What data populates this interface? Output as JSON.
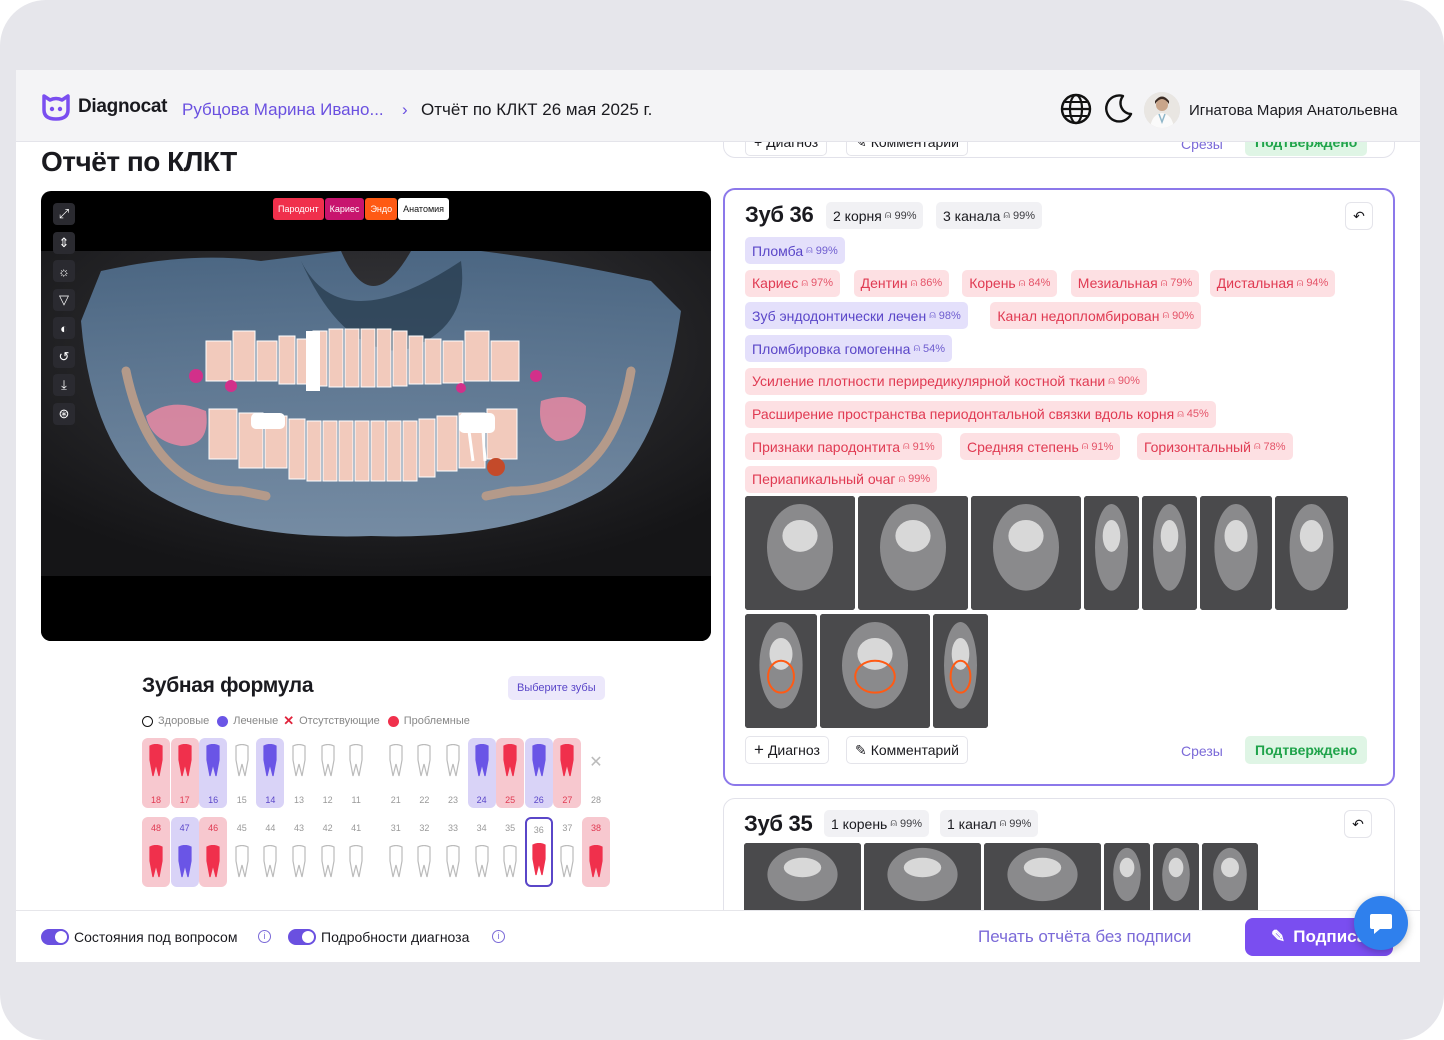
{
  "app": {
    "brand": "Diagnocat"
  },
  "breadcrumb": {
    "patient": "Рубцова Марина Ивано...",
    "separator": "›",
    "report": "Отчёт по КЛКТ 26 мая 2025 г."
  },
  "user": {
    "name": "Игнатова Мария Анатольевна"
  },
  "page_title": "Отчёт по КЛКТ",
  "viewer": {
    "tools": [
      "expand-icon",
      "split-icon",
      "brightness-icon",
      "triangle-icon",
      "contrast-icon",
      "undo-icon",
      "download-icon",
      "tooth-view-icon"
    ],
    "mask_tabs": [
      {
        "label": "Пародонт",
        "color": "#f0304c"
      },
      {
        "label": "Кариес",
        "color": "#c8146e"
      },
      {
        "label": "Эндо",
        "color": "#ff5a14"
      },
      {
        "label": "Анатомия",
        "color": "#ffffff"
      }
    ]
  },
  "formula": {
    "title": "Зубная формула",
    "select_button": "Выберите зубы",
    "legend": {
      "healthy": "Здоровые",
      "treated": "Леченые",
      "missing": "Отсутствующие",
      "problem": "Проблемные"
    },
    "upper": [
      {
        "num": "18",
        "state": "problem"
      },
      {
        "num": "17",
        "state": "problem"
      },
      {
        "num": "16",
        "state": "treated"
      },
      {
        "num": "15",
        "state": "healthy"
      },
      {
        "num": "14",
        "state": "treated"
      },
      {
        "num": "13",
        "state": "healthy"
      },
      {
        "num": "12",
        "state": "healthy"
      },
      {
        "num": "11",
        "state": "healthy"
      },
      {
        "num": "21",
        "state": "healthy"
      },
      {
        "num": "22",
        "state": "healthy"
      },
      {
        "num": "23",
        "state": "healthy"
      },
      {
        "num": "24",
        "state": "treated"
      },
      {
        "num": "25",
        "state": "problem"
      },
      {
        "num": "26",
        "state": "treated"
      },
      {
        "num": "27",
        "state": "problem"
      },
      {
        "num": "28",
        "state": "missing"
      }
    ],
    "lower": [
      {
        "num": "48",
        "state": "problem"
      },
      {
        "num": "47",
        "state": "treated"
      },
      {
        "num": "46",
        "state": "problem"
      },
      {
        "num": "45",
        "state": "healthy"
      },
      {
        "num": "44",
        "state": "healthy"
      },
      {
        "num": "43",
        "state": "healthy"
      },
      {
        "num": "42",
        "state": "healthy"
      },
      {
        "num": "41",
        "state": "healthy"
      },
      {
        "num": "31",
        "state": "healthy"
      },
      {
        "num": "32",
        "state": "healthy"
      },
      {
        "num": "33",
        "state": "healthy"
      },
      {
        "num": "34",
        "state": "healthy"
      },
      {
        "num": "35",
        "state": "healthy"
      },
      {
        "num": "36",
        "state": "problem-selected"
      },
      {
        "num": "37",
        "state": "healthy"
      },
      {
        "num": "38",
        "state": "problem"
      }
    ]
  },
  "prev_card": {
    "add_diagnosis": "Диагноз",
    "comment": "Комментарий",
    "slices": "Срезы",
    "status": "Подтверждено"
  },
  "tooth36": {
    "title": "Зуб 36",
    "roots": {
      "label": "2 корня",
      "pct": "99%"
    },
    "canals": {
      "label": "3 канала",
      "pct": "99%"
    },
    "findings": [
      {
        "label": "Пломба",
        "pct": "99%",
        "tone": "blue"
      },
      {
        "label": "Кариес",
        "pct": "97%",
        "tone": "red"
      },
      {
        "label": "Дентин",
        "pct": "86%",
        "tone": "red"
      },
      {
        "label": "Корень",
        "pct": "84%",
        "tone": "red"
      },
      {
        "label": "Мезиальная",
        "pct": "79%",
        "tone": "red"
      },
      {
        "label": "Дистальная",
        "pct": "94%",
        "tone": "red"
      },
      {
        "label": "Зуб эндодонтически лечен",
        "pct": "98%",
        "tone": "blue"
      },
      {
        "label": "Канал недопломбирован",
        "pct": "90%",
        "tone": "red"
      },
      {
        "label": "Пломбировка гомогенна",
        "pct": "54%",
        "tone": "blue"
      },
      {
        "label": "Усиление плотности периредикулярной костной ткани",
        "pct": "90%",
        "tone": "red"
      },
      {
        "label": "Расширение пространства периодонтальной связки вдоль корня",
        "pct": "45%",
        "tone": "red"
      },
      {
        "label": "Признаки пародонтита",
        "pct": "91%",
        "tone": "red"
      },
      {
        "label": "Средняя степень",
        "pct": "91%",
        "tone": "red"
      },
      {
        "label": "Горизонтальный",
        "pct": "78%",
        "tone": "red"
      },
      {
        "label": "Периапикальный очаг",
        "pct": "99%",
        "tone": "red"
      }
    ],
    "add_diagnosis": "Диагноз",
    "comment": "Комментарий",
    "slices": "Срезы",
    "status": "Подтверждено"
  },
  "tooth35": {
    "title": "Зуб 35",
    "roots": {
      "label": "1 корень",
      "pct": "99%"
    },
    "canals": {
      "label": "1 канал",
      "pct": "99%"
    }
  },
  "footer": {
    "toggle1": "Состояния под вопросом",
    "toggle2": "Подробности диагноза",
    "print": "Печать отчёта без подписи",
    "sign": "Подписать"
  },
  "colors": {
    "accent": "#6a50e0",
    "problem": "#f0304c",
    "treated": "#6a55e6",
    "approved": "#1fa34a"
  }
}
